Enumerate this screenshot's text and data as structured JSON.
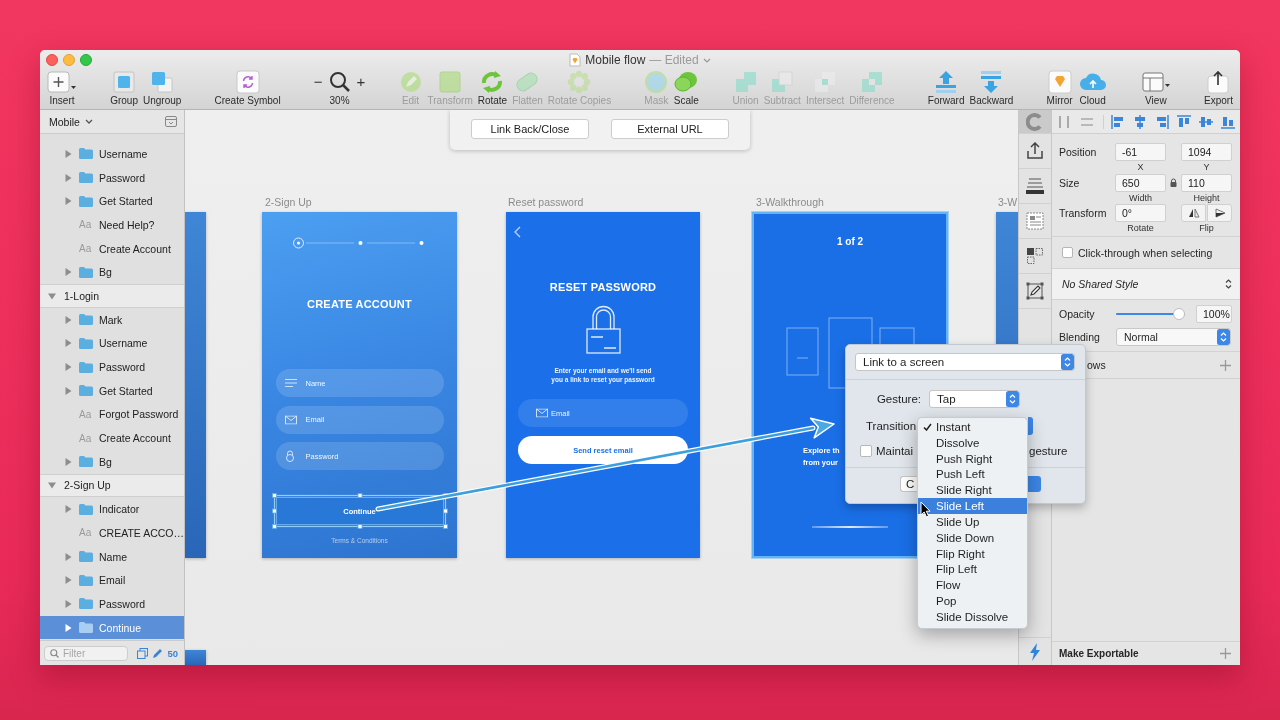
{
  "window": {
    "title": "Mobile flow",
    "status": "— Edited"
  },
  "toolbar": [
    {
      "items": [
        {
          "kind": "insert",
          "label": "Insert",
          "disabled": false
        }
      ]
    },
    {
      "items": [
        {
          "kind": "group",
          "label": "Group",
          "disabled": false
        },
        {
          "kind": "ungroup",
          "label": "Ungroup",
          "disabled": false
        }
      ]
    },
    {
      "items": [
        {
          "kind": "symbol",
          "label": "Create Symbol",
          "disabled": false
        }
      ]
    },
    {
      "items": [
        {
          "kind": "zoom",
          "label": "30%",
          "minus": "−",
          "plus": "+",
          "disabled": false
        }
      ]
    },
    {
      "items": [
        {
          "kind": "edit",
          "label": "Edit",
          "disabled": true
        },
        {
          "kind": "transform",
          "label": "Transform",
          "disabled": true
        },
        {
          "kind": "rotate",
          "label": "Rotate",
          "disabled": false
        },
        {
          "kind": "flatten",
          "label": "Flatten",
          "disabled": true
        },
        {
          "kind": "copies",
          "label": "Rotate Copies",
          "disabled": true
        }
      ]
    },
    {
      "items": [
        {
          "kind": "mask",
          "label": "Mask",
          "disabled": true
        },
        {
          "kind": "scale",
          "label": "Scale",
          "disabled": false
        }
      ]
    },
    {
      "items": [
        {
          "kind": "union",
          "label": "Union",
          "disabled": true
        },
        {
          "kind": "subtract",
          "label": "Subtract",
          "disabled": true
        },
        {
          "kind": "intersect",
          "label": "Intersect",
          "disabled": true
        },
        {
          "kind": "difference",
          "label": "Difference",
          "disabled": true
        }
      ]
    },
    {
      "items": [
        {
          "kind": "forward",
          "label": "Forward",
          "disabled": false
        },
        {
          "kind": "backward",
          "label": "Backward",
          "disabled": false
        }
      ]
    },
    {
      "items": [
        {
          "kind": "mirror",
          "label": "Mirror",
          "disabled": false
        },
        {
          "kind": "cloud",
          "label": "Cloud",
          "disabled": false
        }
      ]
    },
    {
      "items": [
        {
          "kind": "view",
          "label": "View",
          "disabled": false
        }
      ]
    },
    {
      "items": [
        {
          "kind": "export",
          "label": "Export",
          "disabled": false
        }
      ]
    }
  ],
  "layers": {
    "page": "Mobile",
    "sections": [
      {
        "children": [
          {
            "kind": "folder",
            "name": "Username",
            "expanded": false,
            "selected": false
          },
          {
            "kind": "folder",
            "name": "Password",
            "expanded": false,
            "selected": false
          },
          {
            "kind": "folder",
            "name": "Get Started",
            "expanded": false,
            "selected": false
          },
          {
            "kind": "text",
            "glyph": "Aa",
            "name": "Need Help?",
            "selected": false
          },
          {
            "kind": "text",
            "glyph": "Aa",
            "name": "Create Account",
            "selected": false
          },
          {
            "kind": "folder",
            "name": "Bg",
            "expanded": false,
            "selected": false
          }
        ]
      },
      {
        "name": "1-Login",
        "expanded": true,
        "selected": false,
        "children": [
          {
            "kind": "folder",
            "name": "Mark",
            "expanded": false,
            "selected": false
          },
          {
            "kind": "folder",
            "name": "Username",
            "expanded": false,
            "selected": false
          },
          {
            "kind": "folder",
            "name": "Password",
            "expanded": false,
            "selected": false
          },
          {
            "kind": "folder",
            "name": "Get Started",
            "expanded": false,
            "selected": false
          },
          {
            "kind": "text",
            "glyph": "Aa",
            "name": "Forgot Password",
            "selected": false
          },
          {
            "kind": "text",
            "glyph": "Aa",
            "name": "Create Account",
            "selected": false
          },
          {
            "kind": "folder",
            "name": "Bg",
            "expanded": false,
            "selected": false
          }
        ]
      },
      {
        "name": "2-Sign Up",
        "expanded": true,
        "selected": false,
        "children": [
          {
            "kind": "folder",
            "name": "Indicator",
            "expanded": false,
            "selected": false
          },
          {
            "kind": "text",
            "glyph": "Aa",
            "name": "CREATE ACCO…",
            "selected": false
          },
          {
            "kind": "folder",
            "name": "Name",
            "expanded": false,
            "selected": false
          },
          {
            "kind": "folder",
            "name": "Email",
            "expanded": false,
            "selected": false
          },
          {
            "kind": "folder",
            "name": "Password",
            "expanded": false,
            "selected": false
          },
          {
            "kind": "folder",
            "name": "Continue",
            "expanded": false,
            "selected": true
          }
        ]
      }
    ],
    "filter": {
      "placeholder": "Filter"
    },
    "count": "50"
  },
  "canvas": {
    "link_options": [
      "Link Back/Close",
      "External URL"
    ],
    "artboards": [
      {
        "kind": "edge",
        "targeted": false
      },
      {
        "kind": "signup",
        "label": "2-Sign Up",
        "title": "CREATE ACCOUNT",
        "fields": [
          {
            "kind": "name",
            "placeholder": "Name"
          },
          {
            "kind": "email",
            "placeholder": "Email"
          },
          {
            "kind": "password",
            "placeholder": "Password"
          }
        ],
        "button": {
          "label": "Continue",
          "selected": true
        },
        "footer": "Terms & Conditions",
        "targeted": false
      },
      {
        "kind": "reset",
        "label": "Reset password",
        "title": "RESET PASSWORD",
        "message": "Enter your email and we'll send\nyou a link to reset your password",
        "fields": [
          {
            "kind": "email",
            "placeholder": "Email"
          }
        ],
        "button": {
          "label": "Send reset email",
          "selected": false
        },
        "targeted": false
      },
      {
        "kind": "walkthrough",
        "label": "3-Walkthrough",
        "title": "1 of 2",
        "text": "Explore th\nfrom your",
        "targeted": true
      },
      {
        "kind": "edge",
        "label": "3-W",
        "targeted": false
      }
    ]
  },
  "link_popup": {
    "target": "Link to a screen",
    "gesture_label": "Gesture:",
    "gesture": "Tap",
    "transition_label": "Transition",
    "maintain": {
      "text_start": "Maintai",
      "text_end": "gesture",
      "checked": false
    },
    "cancel": "C"
  },
  "transition_menu": [
    {
      "label": "Instant",
      "checked": true,
      "highlighted": false
    },
    {
      "label": "Dissolve",
      "checked": false,
      "highlighted": false
    },
    {
      "label": "Push Right",
      "checked": false,
      "highlighted": false
    },
    {
      "label": "Push Left",
      "checked": false,
      "highlighted": false
    },
    {
      "label": "Slide Right",
      "checked": false,
      "highlighted": false
    },
    {
      "label": "Slide Left",
      "checked": false,
      "highlighted": true
    },
    {
      "label": "Slide Up",
      "checked": false,
      "highlighted": false
    },
    {
      "label": "Slide Down",
      "checked": false,
      "highlighted": false
    },
    {
      "label": "Flip Right",
      "checked": false,
      "highlighted": false
    },
    {
      "label": "Flip Left",
      "checked": false,
      "highlighted": false
    },
    {
      "label": "Flow",
      "checked": false,
      "highlighted": false
    },
    {
      "label": "Pop",
      "checked": false,
      "highlighted": false
    },
    {
      "label": "Slide Dissolve",
      "checked": false,
      "highlighted": false
    }
  ],
  "inspector": {
    "geometry": [
      {
        "label": "Position",
        "locked": false,
        "fields": [
          {
            "kind": "number",
            "value": "-61",
            "caption": "X"
          },
          {
            "kind": "number",
            "value": "1094",
            "caption": "Y"
          }
        ]
      },
      {
        "label": "Size",
        "locked": true,
        "fields": [
          {
            "kind": "number",
            "value": "650",
            "caption": "Width"
          },
          {
            "kind": "number",
            "value": "110",
            "caption": "Height"
          }
        ]
      },
      {
        "label": "Transform",
        "locked": false,
        "fields": [
          {
            "kind": "number",
            "value": "0°",
            "caption": "Rotate"
          },
          {
            "kind": "flip",
            "caption": "Flip"
          }
        ]
      }
    ],
    "click_through": {
      "label": "Click-through when selecting",
      "checked": false
    },
    "shared_style": "No Shared Style",
    "opacity": {
      "label": "Opacity",
      "level": 1,
      "value": "100%"
    },
    "blending": {
      "label": "Blending",
      "value": "Normal"
    },
    "shadows": {
      "label": "ows"
    },
    "export": {
      "label": "Make Exportable"
    }
  }
}
